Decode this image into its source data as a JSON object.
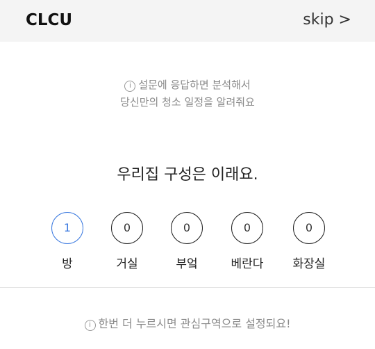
{
  "header": {
    "title": "CLCU",
    "skip_label": "skip >"
  },
  "intro": {
    "icon": "info-icon",
    "line1": "설문에 응답하면 분석해서",
    "line2": "당신만의 청소 일정을 알려줘요"
  },
  "question": "우리집 구성은 이래요.",
  "rooms": [
    {
      "label": "방",
      "count": "1",
      "selected": true
    },
    {
      "label": "거실",
      "count": "0",
      "selected": false
    },
    {
      "label": "부엌",
      "count": "0",
      "selected": false
    },
    {
      "label": "베란다",
      "count": "0",
      "selected": false
    },
    {
      "label": "화장실",
      "count": "0",
      "selected": false
    }
  ],
  "hint": "한번 더 누르시면 관심구역으로 설정되요!",
  "colors": {
    "header_bg": "#f4f4f4",
    "accent": "#3d7be0",
    "info_text": "#8a8a8a"
  }
}
